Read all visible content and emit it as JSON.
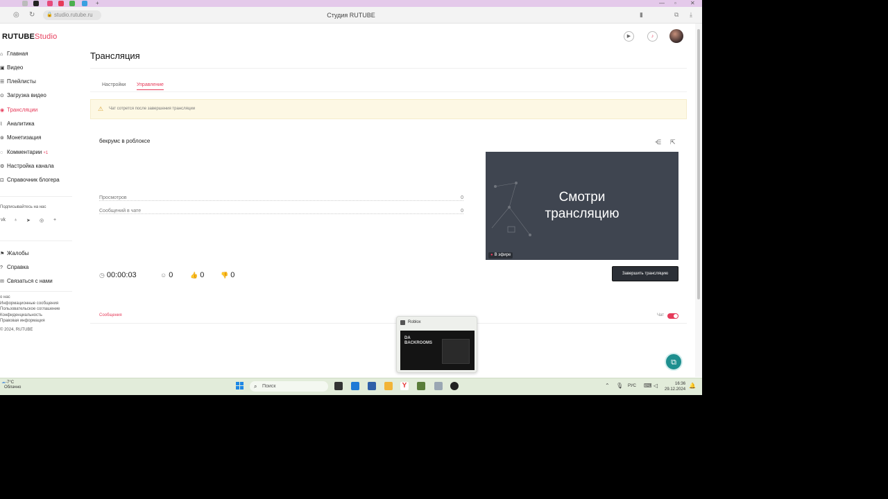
{
  "browser": {
    "url": "studio.rutube.ru",
    "window_title": "Студия RUTUBE"
  },
  "app": {
    "logo_main": "RUTUBE",
    "logo_sub": "Studio"
  },
  "sidebar": {
    "items": [
      {
        "label": "Главная",
        "icon": "home-icon"
      },
      {
        "label": "Видео",
        "icon": "video-icon"
      },
      {
        "label": "Плейлисты",
        "icon": "playlist-icon"
      },
      {
        "label": "Загрузка видео",
        "icon": "upload-icon"
      },
      {
        "label": "Трансляции",
        "icon": "broadcast-icon",
        "active": true
      },
      {
        "label": "Аналитика",
        "icon": "analytics-icon"
      },
      {
        "label": "Монетизация",
        "icon": "money-icon"
      },
      {
        "label": "Комментарии",
        "icon": "comment-icon",
        "badge": "+1"
      },
      {
        "label": "Настройка канала",
        "icon": "settings-icon"
      },
      {
        "label": "Справочник блогера",
        "icon": "book-icon"
      }
    ],
    "follow_label": "Подписывайтесь на нас",
    "support_items": [
      {
        "label": "Жалобы"
      },
      {
        "label": "Справка"
      },
      {
        "label": "Связаться с нами"
      }
    ],
    "footer_links": [
      "о нас",
      "Информационные сообщения",
      "Пользовательское соглашение",
      "Конфиденциальность",
      "Правовая информация",
      "© 2024, RUTUBE"
    ]
  },
  "main": {
    "title": "Трансляция",
    "tabs": [
      {
        "label": "Настройки"
      },
      {
        "label": "Управление",
        "active": true
      }
    ],
    "warning": "Чат сотрется после завершения трансляции",
    "stream": {
      "name": "бекрумс в роблоксе",
      "stats": [
        {
          "label": "Просмотров",
          "value": "0"
        },
        {
          "label": "Сообщений в чате",
          "value": "0"
        }
      ],
      "duration": "00:00:03",
      "viewers": "0",
      "likes": "0",
      "dislikes": "0",
      "preview_line1": "Смотри",
      "preview_line2": "трансляцию",
      "live_badge": "В эфире",
      "end_button": "Завершить трансляцию"
    },
    "messages_tab": "Сообщения",
    "chat_label": "Чат"
  },
  "taskbar": {
    "weather_temp": "-7°C",
    "weather_desc": "Облачно",
    "search_placeholder": "Поиск",
    "lang": "РУС",
    "time": "16:36",
    "date": "29.12.2024",
    "popup_title": "Roblox",
    "popup_game_text": "DA BACKROOMS"
  },
  "colors": {
    "accent": "#e63b5a",
    "support": "#1e8f8f"
  }
}
